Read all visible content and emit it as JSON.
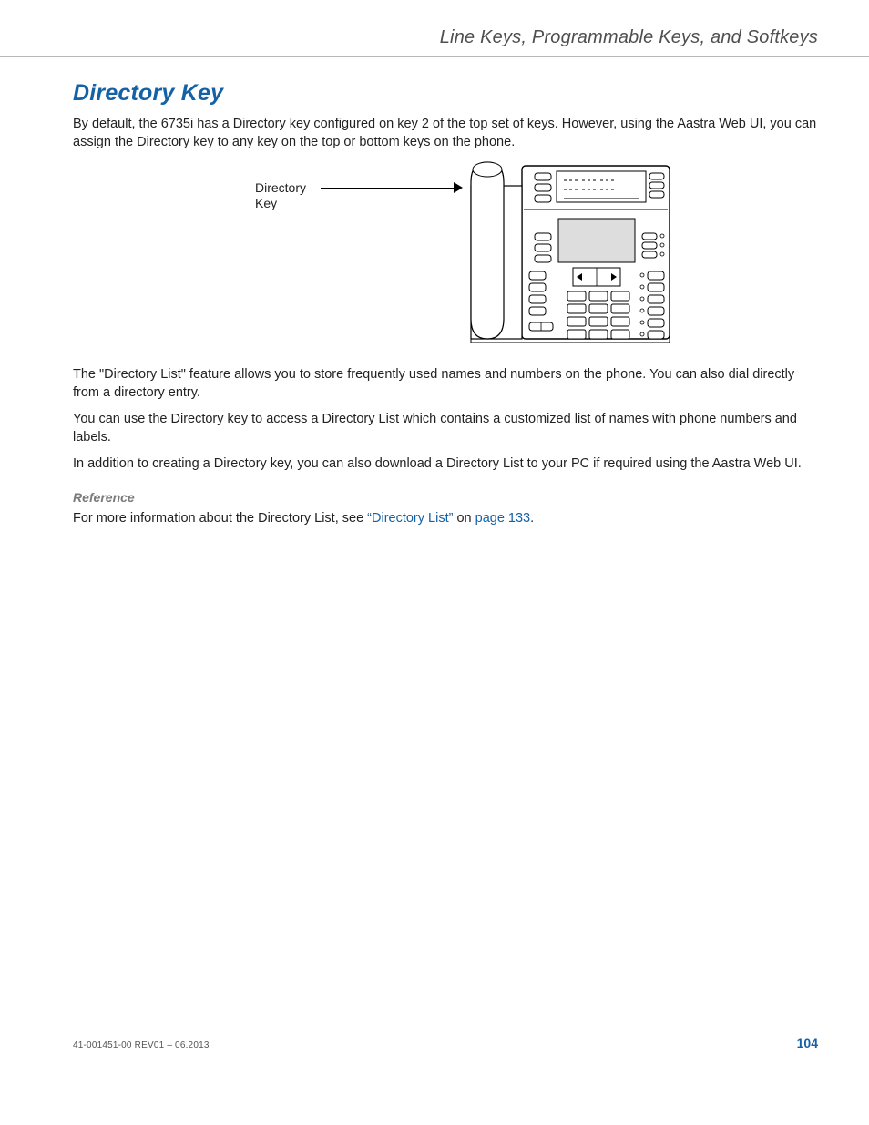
{
  "header": {
    "running_title": "Line Keys, Programmable Keys, and Softkeys"
  },
  "section": {
    "title": "Directory Key",
    "p1": "By default, the 6735i has a Directory key configured on key 2 of the top set of keys. However, using the Aastra Web UI, you can assign the Directory key to any key on the top or bottom keys on the phone.",
    "figure": {
      "callout_line1": "Directory",
      "callout_line2": "Key"
    },
    "p2": "The \"Directory List\" feature allows you to store frequently used names and numbers on the phone. You can also dial directly from a directory entry.",
    "p3": "You can use the Directory key to access a Directory List which contains a customized list of names with phone numbers and labels.",
    "p4": "In addition to creating a Directory key, you can also download a Directory List to your PC if required using the Aastra Web UI.",
    "reference_heading": "Reference",
    "reference_prefix": "For more information about the Directory List, see ",
    "reference_link": "“Directory List”",
    "reference_on": " on ",
    "reference_pageref": "page 133",
    "reference_suffix": "."
  },
  "footer": {
    "left": "41-001451-00 REV01 – 06.2013",
    "page": "104"
  }
}
